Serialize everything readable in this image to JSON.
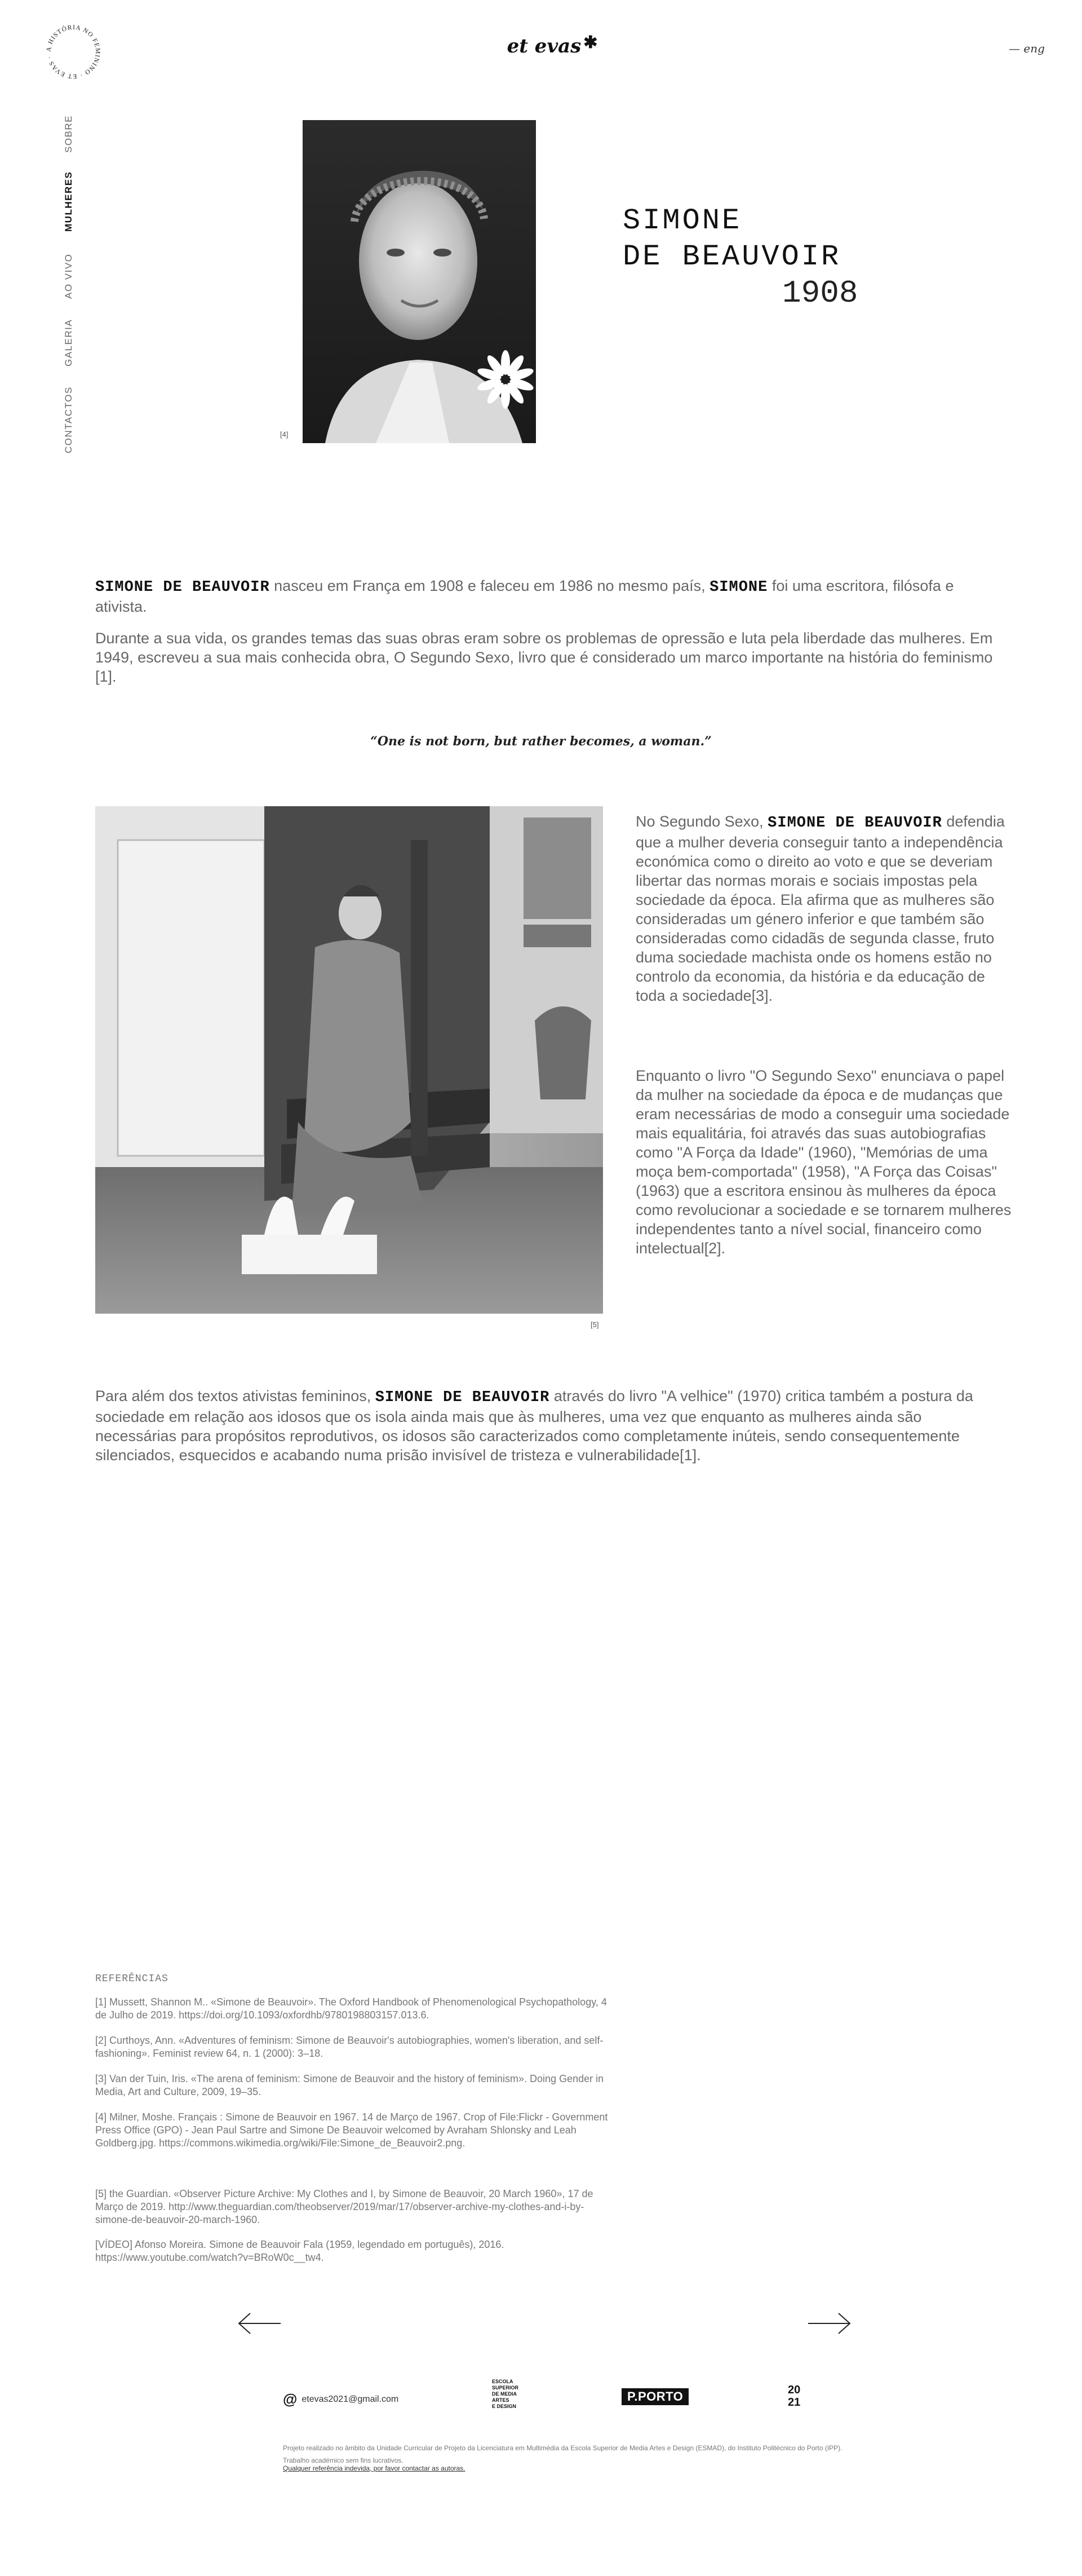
{
  "header": {
    "circle_logo_text": "A HISTÓRIA NO FEMININO · ET EVAS ·",
    "brand": "et evas",
    "brand_star": "✱",
    "lang": "— eng"
  },
  "nav": {
    "items": [
      {
        "label": "SOBRE"
      },
      {
        "label": "MULHERES"
      },
      {
        "label": "AO VIVO"
      },
      {
        "label": "GALERIA"
      },
      {
        "label": "CONTACTOS"
      }
    ]
  },
  "hero": {
    "caption": "[4]",
    "title_line1": "SIMONE",
    "title_line2": "DE BEAUVOIR",
    "year": "1908"
  },
  "intro": {
    "p1_name": "SIMONE DE BEAUVOIR",
    "p1_text_a": " nasceu em França em 1908 e faleceu em 1986 no mesmo país, ",
    "p1_name2": "SIMONE",
    "p1_text_b": " foi uma escritora, filósofa e ativista.",
    "p2": "Durante a sua vida, os grandes temas das suas obras eram sobre os problemas de opressão e luta pela liberdade das mulheres. Em 1949, escreveu a sua mais conhecida obra, O Segundo Sexo, livro que é considerado um marco importante na história do feminismo [1]."
  },
  "quote": "“One is not born, but rather becomes, a woman.”",
  "section2": {
    "photo_caption": "[5]",
    "c1_a": "No Segundo Sexo, ",
    "c1_name": "SIMONE DE BEAUVOIR",
    "c1_b": " defendia que a mulher deveria conseguir tanto a independência económica como o direito ao voto e que se deveriam libertar das normas morais e sociais impostas pela sociedade da época. Ela afirma que as mulheres são consideradas um género inferior e que também são consideradas como cidadãs de segunda classe, fruto duma sociedade machista onde os homens estão no controlo da economia, da história e da educação de toda a sociedade[3].",
    "c2": "Enquanto o livro \"O Segundo Sexo\" enunciava o papel da mulher na sociedade da época e de mudanças que eram necessárias de modo a conseguir uma sociedade mais equalitária, foi através das suas autobiografias como \"A Força da Idade\" (1960), \"Memórias de uma moça bem-comportada\" (1958), \"A Força das Coisas\" (1963) que a escritora ensinou às mulheres da época como revolucionar a sociedade e se tornarem mulheres independentes tanto a nível social, financeiro como intelectual[2]."
  },
  "section3": {
    "a": "Para além dos textos ativistas femininos, ",
    "name": "SIMONE DE BEAUVOIR",
    "b": "  através do livro \"A velhice\" (1970) critica também a postura da sociedade em relação aos idosos que os isola ainda mais que às mulheres, uma vez que enquanto as mulheres ainda são necessárias para propósitos reprodutivos, os idosos são caracterizados como completamente inúteis, sendo consequentemente silenciados, esquecidos e acabando numa prisão invisível de tristeza e vulnerabilidade[1]."
  },
  "references": {
    "title": "REFERÊNCIAS",
    "items": [
      "[1] Mussett, Shannon M.. «Simone de Beauvoir». The Oxford Handbook of Phenomenological Psychopathology, 4 de Julho de 2019. https://doi.org/10.1093/oxfordhb/9780198803157.013.6.",
      "[2] Curthoys, Ann. «Adventures of feminism: Simone de Beauvoir's autobiographies, women's liberation, and self-fashioning». Feminist review 64, n. 1 (2000): 3–18.",
      "[3] Van der Tuin, Iris. «The arena of feminism: Simone de Beauvoir and the history of feminism». Doing Gender in Media, Art and Culture, 2009, 19–35.",
      "[4] Milner, Moshe. Français : Simone de Beauvoir en 1967. 14 de Março de 1967. Crop of File:Flickr - Government Press Office (GPO) - Jean Paul Sartre and Simone De Beauvoir welcomed by Avraham Shlonsky and Leah Goldberg.jpg. https://commons.wikimedia.org/wiki/File:Simone_de_Beauvoir2.png.",
      "[5] the Guardian. «Observer Picture Archive: My Clothes and I, by Simone de Beauvoir, 20 March 1960», 17 de Março de 2019. http://www.theguardian.com/theobserver/2019/mar/17/observer-archive-my-clothes-and-i-by-simone-de-beauvoir-20-march-1960.",
      "[VÍDEO] Afonso Moreira. Simone de Beauvoir Fala (1959, legendado em português), 2016. https://www.youtube.com/watch?v=BRoW0c__tw4."
    ]
  },
  "nav_arrows": {
    "prev_icon": "arrow-left-icon",
    "next_icon": "arrow-right-icon"
  },
  "footer": {
    "at": "@",
    "email": "etevas2021@gmail.com",
    "esmad": "ESCOLA\nSUPERIOR\nDE MEDIA\nARTES\nE DESIGN",
    "pporto": "P.PORTO",
    "year_top": "20",
    "year_bottom": "21",
    "credits": "Projeto realizado no âmbito da Unidade Curricular de Projeto da Licenciatura em Multimédia da Escola Superior de Media Artes e Design (ESMAD), do Instituto Politécnico do Porto (IPP).",
    "academic": "Trabalho académico sem fins lucrativos.",
    "contact_link": "Qualquer referência indevida, por favor contactar as autoras."
  }
}
